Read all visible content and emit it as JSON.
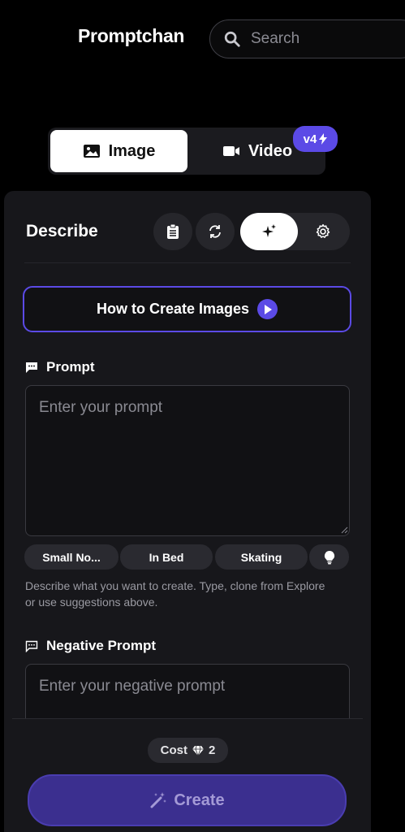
{
  "header": {
    "logo_text": "Promptchan",
    "search_placeholder": "Search"
  },
  "mode_toggle": {
    "image_label": "Image",
    "video_label": "Video",
    "badge": "v4",
    "active": "Image"
  },
  "describe": {
    "title": "Describe",
    "tools": [
      "clipboard-icon",
      "refresh-icon",
      "sparkles-icon",
      "gear-icon"
    ],
    "active_tool": "sparkles-icon"
  },
  "howto": {
    "label": "How to Create Images"
  },
  "prompt": {
    "label": "Prompt",
    "placeholder": "Enter your prompt",
    "value": "",
    "suggestions": [
      "Small No...",
      "In Bed",
      "Skating"
    ],
    "help_text": "Describe what you want to create. Type, clone from Explore or use suggestions above."
  },
  "negative_prompt": {
    "label": "Negative Prompt",
    "placeholder": "Enter your negative prompt",
    "value": ""
  },
  "footer": {
    "cost_label": "Cost",
    "cost_value": "2",
    "create_label": "Create"
  },
  "colors": {
    "accent": "#5b4ae6",
    "panel": "#17171b",
    "create_bg": "#3b2f8f"
  }
}
